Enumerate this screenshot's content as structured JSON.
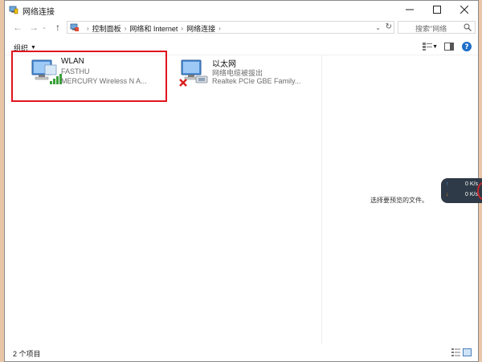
{
  "window": {
    "title": "网络连接"
  },
  "address_bar": {
    "crumbs": [
      "控制面板",
      "网络和 Internet",
      "网络连接"
    ]
  },
  "search": {
    "placeholder": "搜索\"网络"
  },
  "toolbar": {
    "organize_label": "组织"
  },
  "connections": [
    {
      "name": "WLAN",
      "status": "FASTHU",
      "device": "MERCURY Wireless N A...",
      "selected": true,
      "icon": "wireless-network-icon"
    },
    {
      "name": "以太网",
      "status": "网络电缆被拔出",
      "device": "Realtek PCIe GBE Family...",
      "selected": false,
      "icon": "ethernet-disconnected-icon"
    }
  ],
  "preview": {
    "text": "选择要预览的文件。"
  },
  "status_bar": {
    "count_text": "2 个项目"
  },
  "net_widget": {
    "upload": "0 K/s",
    "download": "0 K/s"
  },
  "colors": {
    "selection_outline": "#e0141e",
    "upload_arrow": "#4aa3e0",
    "download_arrow": "#e9902a",
    "widget_bg": "#2e3a47",
    "help_blue": "#1e6fc8"
  }
}
